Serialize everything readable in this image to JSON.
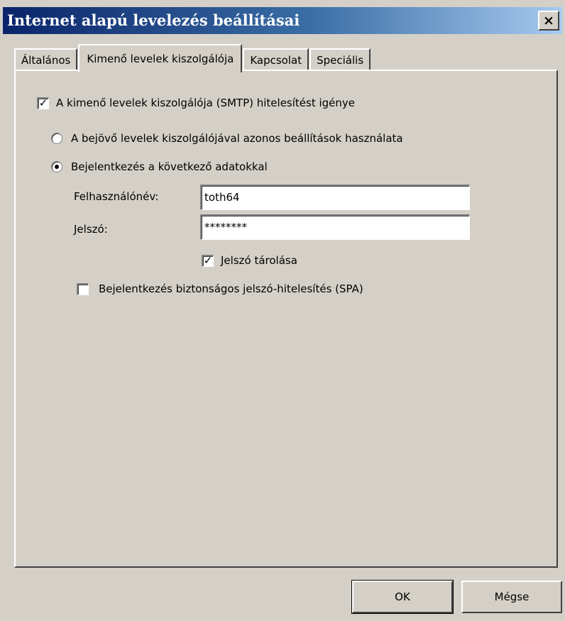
{
  "window": {
    "title": "Internet alapú levelezés beállításai",
    "close_glyph": "×"
  },
  "tabs": [
    {
      "label": "Általános",
      "active": false
    },
    {
      "label": "Kimenő levelek kiszolgálója",
      "active": true
    },
    {
      "label": "Kapcsolat",
      "active": false
    },
    {
      "label": "Speciális",
      "active": false
    }
  ],
  "panel": {
    "smtp_auth": {
      "label": "A kimenő levelek kiszolgálója (SMTP) hitelesítést igénye",
      "checked": true
    },
    "radio_same_settings": {
      "label": "A bejövő levelek kiszolgálójával azonos beállítások használata",
      "selected": false
    },
    "radio_login_with": {
      "label": "Bejelentkezés a következő adatokkal",
      "selected": true
    },
    "username": {
      "label": "Felhasználónév:",
      "value": "toth64"
    },
    "password": {
      "label": "Jelszó:",
      "value": "********"
    },
    "remember_password": {
      "label": "Jelszó tárolása",
      "checked": true
    },
    "spa": {
      "label": "Bejelentkezés biztonságos jelszó-hitelesítés (SPA)",
      "checked": false
    }
  },
  "buttons": {
    "ok": "OK",
    "cancel": "Mégse"
  },
  "glyphs": {
    "check": "✓"
  }
}
